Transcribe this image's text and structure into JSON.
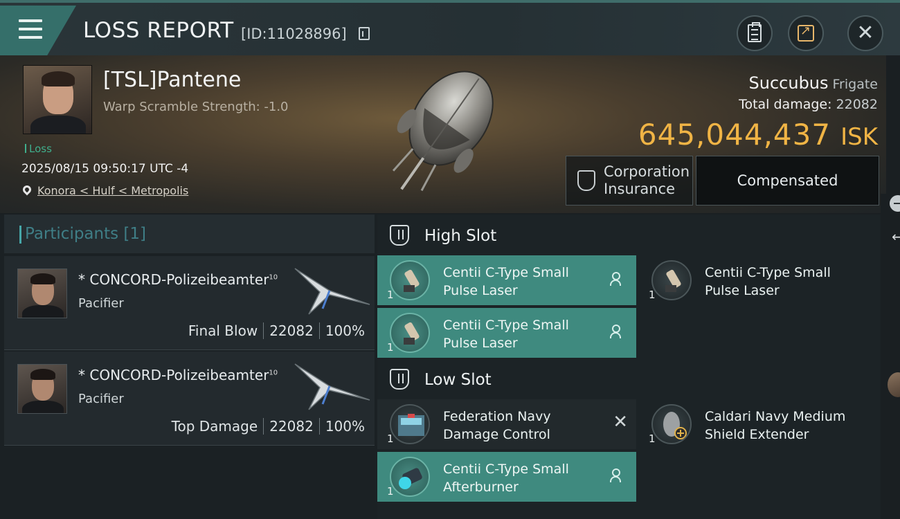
{
  "header": {
    "title": "LOSS REPORT",
    "report_id": "[ID:11028896]"
  },
  "victim": {
    "pilot_name": "[TSL]Pantene",
    "warp_scramble": "Warp Scramble Strength: -1.0",
    "loss_tag": "Loss",
    "datetime": "2025/08/15 09:50:17 UTC -4",
    "location": "Konora < Hulf < Metropolis",
    "ship_name": "Succubus",
    "ship_class": "Frigate",
    "total_damage_label": "Total damage:",
    "total_damage": "22082",
    "isk_value": "645,044,437",
    "isk_unit": "ISK",
    "insurance_label_1": "Corporation",
    "insurance_label_2": "Insurance",
    "compensation_status": "Compensated"
  },
  "participants": {
    "label": "Participants [1]",
    "rows": [
      {
        "name": "* CONCORD-Polizeibeamter",
        "level": "10",
        "ship": "Pacifier",
        "role": "Final Blow",
        "damage": "22082",
        "percent": "100%"
      },
      {
        "name": "* CONCORD-Polizeibeamter",
        "level": "10",
        "ship": "Pacifier",
        "role": "Top Damage",
        "damage": "22082",
        "percent": "100%"
      }
    ]
  },
  "slots": {
    "high": {
      "label": "High Slot",
      "modules": [
        {
          "qty": "1",
          "name_1": "Centii C-Type Small",
          "name_2": "Pulse Laser",
          "status": "dropped"
        },
        {
          "qty": "1",
          "name_1": "Centii C-Type Small",
          "name_2": "Pulse Laser",
          "status": "destroyed"
        },
        {
          "qty": "1",
          "name_1": "Centii C-Type Small",
          "name_2": "Pulse Laser",
          "status": "dropped"
        }
      ]
    },
    "low": {
      "label": "Low Slot",
      "modules": [
        {
          "qty": "1",
          "name_1": "Federation Navy",
          "name_2": "Damage Control",
          "status": "destroyed"
        },
        {
          "qty": "1",
          "name_1": "Caldari Navy Medium",
          "name_2": "Shield Extender",
          "status": "destroyed"
        },
        {
          "qty": "1",
          "name_1": "Centii C-Type Small",
          "name_2": "Afterburner",
          "status": "dropped"
        }
      ]
    }
  },
  "colors": {
    "accent_teal": "#3f8a7f",
    "isk_gold": "#f0b445",
    "loss_green": "#3fae8c"
  }
}
